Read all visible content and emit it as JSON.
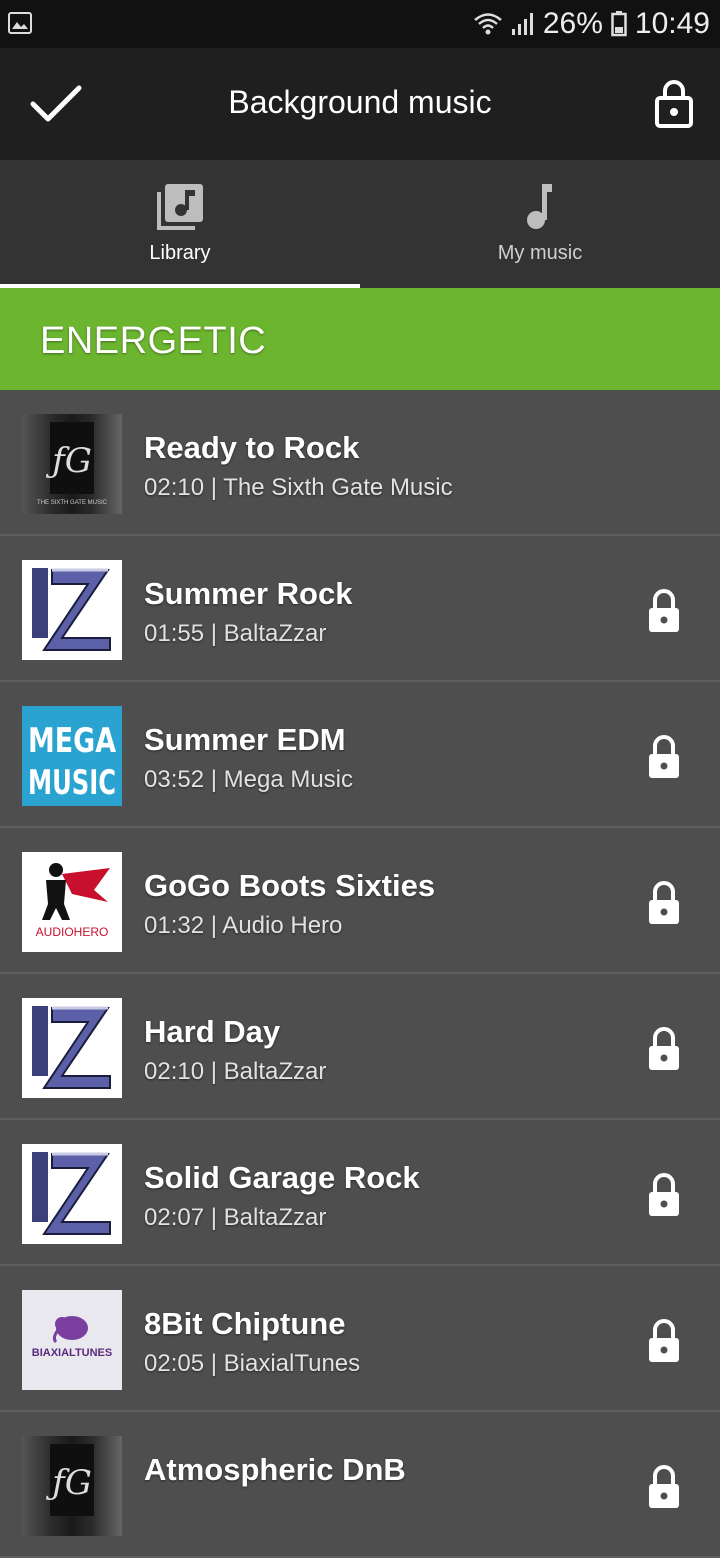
{
  "statusbar": {
    "battery_pct": "26%",
    "time": "10:49"
  },
  "header": {
    "title": "Background music"
  },
  "tabs": [
    {
      "label": "Library",
      "active": true,
      "icon": "library-music-icon"
    },
    {
      "label": "My music",
      "active": false,
      "icon": "music-note-icon"
    }
  ],
  "category": {
    "title": "ENERGETIC"
  },
  "tracks": [
    {
      "title": "Ready to Rock",
      "meta": "02:10 | The Sixth Gate Music",
      "locked": false,
      "art": "sixth-gate",
      "art_text": "THE SIXTH GATE MUSIC"
    },
    {
      "title": "Summer Rock",
      "meta": "01:55 | BaltaZzar",
      "locked": true,
      "art": "baltazzar",
      "art_text": ""
    },
    {
      "title": "Summer EDM",
      "meta": "03:52 | Mega Music",
      "locked": true,
      "art": "mega-music",
      "art_text": "MEGA MUSIC"
    },
    {
      "title": "GoGo Boots Sixties",
      "meta": "01:32 | Audio Hero",
      "locked": true,
      "art": "audio-hero",
      "art_text": "AUDIOHERO"
    },
    {
      "title": "Hard Day",
      "meta": "02:10 | BaltaZzar",
      "locked": true,
      "art": "baltazzar",
      "art_text": ""
    },
    {
      "title": "Solid Garage Rock",
      "meta": "02:07 | BaltaZzar",
      "locked": true,
      "art": "baltazzar",
      "art_text": ""
    },
    {
      "title": "8Bit Chiptune",
      "meta": "02:05 | BiaxialTunes",
      "locked": true,
      "art": "biaxialtunes",
      "art_text": "BIAXIALTUNES"
    },
    {
      "title": "Atmospheric DnB",
      "meta": "",
      "locked": true,
      "art": "sixth-gate",
      "art_text": ""
    }
  ],
  "colors": {
    "accent": "#6bb52f",
    "background": "#4e4e4e",
    "header": "#1f1f1f",
    "tabs": "#333333"
  }
}
